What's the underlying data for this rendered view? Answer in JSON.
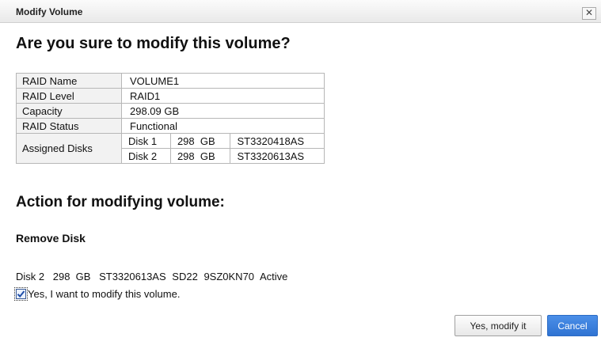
{
  "dialog": {
    "title": "Modify Volume",
    "close_label": "✕"
  },
  "question": "Are you sure to modify this volume?",
  "raid_info": {
    "rows": [
      {
        "label": "RAID Name",
        "value": "VOLUME1"
      },
      {
        "label": "RAID Level",
        "value": "RAID1"
      },
      {
        "label": "Capacity",
        "value": "298.09 GB"
      },
      {
        "label": "RAID Status",
        "value": "Functional"
      }
    ],
    "assigned_label": "Assigned Disks",
    "disks": [
      {
        "name": "Disk 1",
        "size": "298  GB",
        "model": "ST3320418AS"
      },
      {
        "name": "Disk 2",
        "size": "298  GB",
        "model": "ST3320613AS"
      }
    ]
  },
  "action": {
    "heading": "Action for modifying volume:",
    "type": "Remove Disk",
    "disk": {
      "name": "Disk 2",
      "size": "298  GB",
      "model": "ST3320613AS",
      "firmware": "SD22",
      "serial": "9SZ0KN70",
      "status": "Active"
    },
    "confirm_label": "Yes, I want to modify this volume.",
    "confirm_checked": true
  },
  "buttons": {
    "confirm": "Yes, modify it",
    "cancel": "Cancel"
  },
  "colors": {
    "accent": "#2f73d2",
    "checkmark": "#1f4fa8"
  }
}
